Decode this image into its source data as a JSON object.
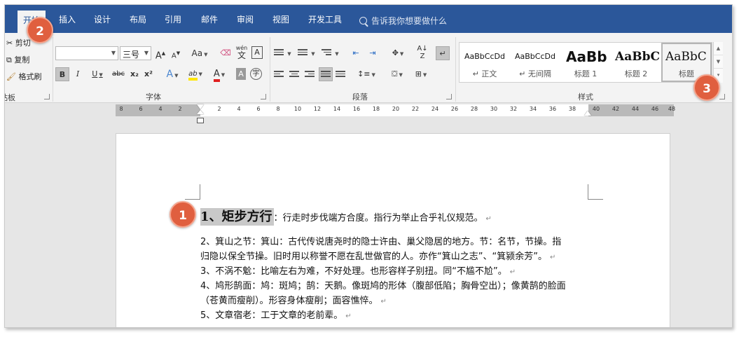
{
  "tabs": {
    "home": "开始",
    "insert": "插入",
    "design": "设计",
    "layout": "布局",
    "references": "引用",
    "mailings": "邮件",
    "review": "审阅",
    "view": "视图",
    "developer": "开发工具"
  },
  "tell_me": "告诉我你想要做什么",
  "clipboard": {
    "cut": "剪切",
    "copy": "复制",
    "format_painter": "格式刷",
    "group_label": "剪贴板"
  },
  "font": {
    "name": "",
    "size": "三号",
    "group_label": "字体",
    "grow": "A",
    "shrink": "A",
    "case": "Aa",
    "phonetic_top": "wén",
    "phonetic_char": "文",
    "border_char": "A",
    "bold": "B",
    "italic": "I",
    "underline": "U",
    "strike": "abc",
    "subscript": "x₂",
    "superscript": "x²",
    "effects": "A",
    "highlight": "ab",
    "color": "A",
    "shading_char": "A",
    "enclose_char": "字"
  },
  "paragraph": {
    "group_label": "段落"
  },
  "styles": {
    "group_label": "样式",
    "items": [
      {
        "preview": "AaBbCcDd",
        "name": "↵ 正文"
      },
      {
        "preview": "AaBbCcDd",
        "name": "↵ 无间隔"
      },
      {
        "preview": "AaBb",
        "name": "标题 1"
      },
      {
        "preview": "AaBbC",
        "name": "标题 2"
      },
      {
        "preview": "AaBbC",
        "name": "标题"
      }
    ]
  },
  "ruler": {
    "left_ticks": [
      "8",
      "6",
      "4",
      "2"
    ],
    "right_ticks": [
      "2",
      "4",
      "6",
      "8",
      "10",
      "12",
      "14",
      "16",
      "18",
      "20",
      "22",
      "24",
      "26",
      "28",
      "30",
      "32",
      "34",
      "36",
      "38",
      "40",
      "42",
      "44",
      "46",
      "48"
    ]
  },
  "document": {
    "heading": "1、矩步方行",
    "heading_rest": "：行走时步伐端方合度。指行为举止合乎礼仪规范。",
    "lines": [
      "2、箕山之节：箕山：古代传说唐尧时的隐士许由、巢父隐居的地方。节：名节，节操。指",
      "归隐以保全节操。旧时用以称誉不愿在乱世做官的人。亦作“箕山之志”、“箕颍余芳”。",
      "3、不涡不魀：比喻左右为难，不好处理。也形容样子别扭。同“不尴不尬”。",
      "4、鸠形鹄面：鸠：斑鸠；鹄：天鹅。像斑鸠的形体（腹部低陷；胸骨空出）；像黄鹄的脸面",
      "（苍黄而瘦削）。形容身体瘦削；面容憔悴。",
      "5、文章宿老：工于文章的老前辈。"
    ],
    "para_mark": "↵"
  },
  "badges": {
    "one": "1",
    "two": "2",
    "three": "3"
  }
}
